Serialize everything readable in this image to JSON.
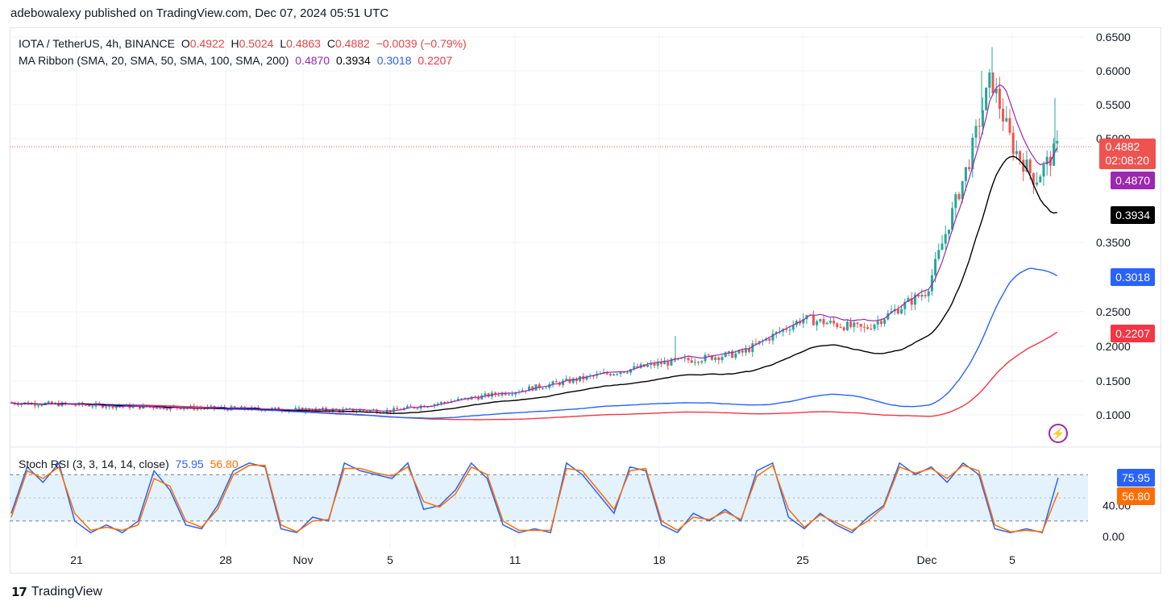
{
  "header": {
    "publisher_line": "adebowalexy published on TradingView.com, Dec 07, 2024 05:51 UTC"
  },
  "legend": {
    "symbol": "IOTA / TetherUS, 4h, BINANCE",
    "open_label": "O",
    "open": "0.4922",
    "high_label": "H",
    "high": "0.5024",
    "low_label": "L",
    "low": "0.4863",
    "close_label": "C",
    "close": "0.4882",
    "change": "−0.0039 (−0.79%)",
    "ma_title": "MA Ribbon (SMA, 20, SMA, 50, SMA, 100, SMA, 200)",
    "ma20": "0.4870",
    "ma50": "0.3934",
    "ma100": "0.3018",
    "ma200": "0.2207",
    "stoch_title": "Stoch RSI (3, 3, 14, 14, close)",
    "stoch_k": "75.95",
    "stoch_d": "56.80"
  },
  "price_badges": {
    "last_price": "0.4882",
    "countdown": "02:08:20",
    "ma20": "0.4870",
    "ma50": "0.3934",
    "ma100": "0.3018",
    "ma200": "0.2207",
    "stoch_k": "75.95",
    "stoch_d": "56.80"
  },
  "footer": {
    "brand": "TradingView"
  },
  "colors": {
    "up": "#26a69a",
    "down": "#ef5350",
    "ma20": "#9c27b0",
    "ma50": "#000000",
    "ma100": "#2962ff",
    "ma200": "#f23645",
    "stoch_k": "#2962ff",
    "stoch_d": "#ff6d00",
    "band_fill": "#e3f2fd"
  },
  "chart_data": [
    {
      "type": "candlestick",
      "title": "IOTA / TetherUS, 4h, BINANCE",
      "y_ticks": [
        "0.6500",
        "0.6000",
        "0.5500",
        "0.5000",
        "0.3500",
        "0.2500",
        "0.2000",
        "0.1500",
        "0.1000"
      ],
      "y_range": [
        0.07,
        0.66
      ],
      "x_ticks": [
        "21",
        "28",
        "Nov",
        "5",
        "11",
        "18",
        "25",
        "Dec",
        "5"
      ],
      "key_points": [
        {
          "x": "Oct 17",
          "close": 0.118
        },
        {
          "x": "Oct 24",
          "close": 0.112
        },
        {
          "x": "Oct 31",
          "close": 0.108
        },
        {
          "x": "Nov 5",
          "close": 0.106
        },
        {
          "x": "Nov 11",
          "close": 0.135
        },
        {
          "x": "Nov 18",
          "close": 0.175
        },
        {
          "x": "Nov 22",
          "close": 0.19
        },
        {
          "x": "Nov 25",
          "close": 0.24
        },
        {
          "x": "Nov 28",
          "close": 0.225
        },
        {
          "x": "Dec 1",
          "close": 0.28
        },
        {
          "x": "Dec 3",
          "close": 0.47
        },
        {
          "x": "Dec 4",
          "close": 0.59
        },
        {
          "x": "Dec 5",
          "close": 0.49
        },
        {
          "x": "Dec 6",
          "close": 0.44
        },
        {
          "x": "Dec 7",
          "close": 0.4882
        }
      ],
      "series": [
        {
          "name": "SMA 20",
          "last": 0.487
        },
        {
          "name": "SMA 50",
          "last": 0.3934
        },
        {
          "name": "SMA 100",
          "last": 0.3018
        },
        {
          "name": "SMA 200",
          "last": 0.2207
        }
      ]
    },
    {
      "type": "line",
      "title": "Stoch RSI (3, 3, 14, 14, close)",
      "y_ticks": [
        "40.00",
        "0.00"
      ],
      "y_range": [
        0,
        100
      ],
      "bands": [
        20,
        50,
        80
      ],
      "series": [
        {
          "name": "K",
          "values": [
            30,
            90,
            70,
            95,
            20,
            5,
            15,
            5,
            20,
            85,
            60,
            15,
            10,
            40,
            85,
            95,
            90,
            10,
            5,
            25,
            20,
            95,
            85,
            80,
            75,
            95,
            35,
            40,
            60,
            95,
            75,
            15,
            5,
            10,
            5,
            95,
            80,
            55,
            30,
            90,
            85,
            15,
            5,
            30,
            20,
            35,
            20,
            85,
            95,
            25,
            10,
            30,
            15,
            5,
            25,
            40,
            95,
            80,
            90,
            70,
            95,
            80,
            10,
            5,
            10,
            5,
            76
          ]
        },
        {
          "name": "D",
          "values": [
            25,
            85,
            75,
            90,
            30,
            8,
            12,
            8,
            15,
            75,
            65,
            20,
            12,
            35,
            80,
            92,
            92,
            15,
            6,
            20,
            22,
            88,
            88,
            82,
            78,
            90,
            45,
            38,
            55,
            90,
            80,
            20,
            8,
            8,
            8,
            88,
            85,
            60,
            35,
            85,
            88,
            20,
            8,
            25,
            22,
            32,
            22,
            78,
            92,
            35,
            12,
            28,
            18,
            8,
            20,
            38,
            90,
            82,
            88,
            75,
            92,
            85,
            15,
            6,
            8,
            6,
            57
          ]
        }
      ]
    }
  ]
}
